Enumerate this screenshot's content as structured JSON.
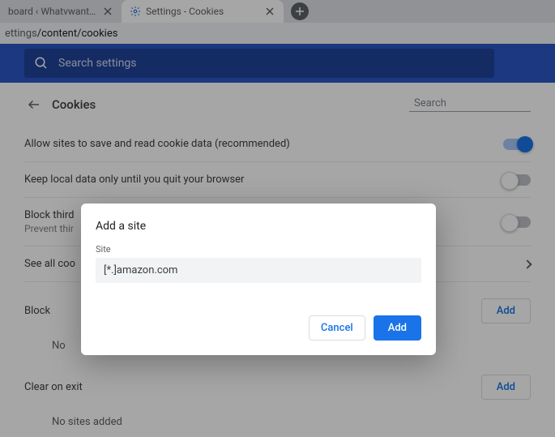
{
  "tabs": {
    "items": [
      {
        "title": "board ‹ Whatvwant — Wor…"
      },
      {
        "title": "Settings - Cookies"
      }
    ]
  },
  "urlbar": {
    "prefix": "ettings",
    "path": "/content/cookies"
  },
  "header": {
    "search_placeholder": "Search settings"
  },
  "page": {
    "title": "Cookies",
    "search_placeholder": "Search"
  },
  "settings": {
    "allow_label": "Allow sites to save and read cookie data (recommended)",
    "keep_local_label": "Keep local data only until you quit your browser",
    "block_third_label": "Block third",
    "block_third_sub": "Prevent thir",
    "see_all_label": "See all coo"
  },
  "sections": {
    "block": {
      "title": "Block",
      "add_label": "Add",
      "empty": "No"
    },
    "clear": {
      "title": "Clear on exit",
      "add_label": "Add",
      "empty": "No sites added"
    }
  },
  "dialog": {
    "title": "Add a site",
    "field_label": "Site",
    "field_value": "[*.]amazon.com",
    "cancel_label": "Cancel",
    "add_label": "Add"
  }
}
